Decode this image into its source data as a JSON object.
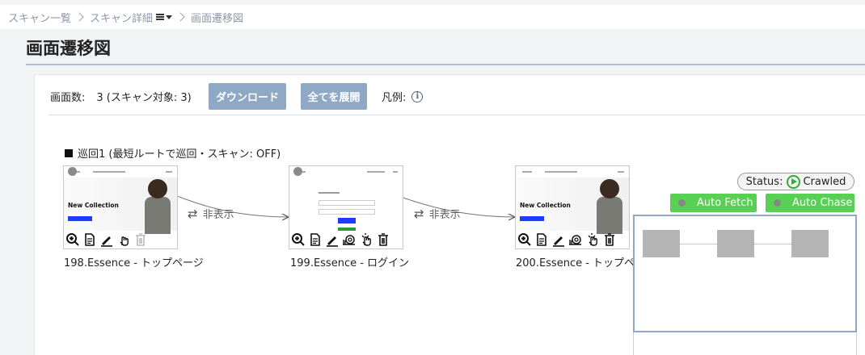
{
  "breadcrumb": {
    "items": [
      "スキャン一覧",
      "スキャン詳細",
      "画面遷移図"
    ]
  },
  "page": {
    "title": "画面遷移図"
  },
  "summary": {
    "screen_count_label": "画面数:",
    "screen_count_value": "3 (スキャン対象: 3)",
    "download_button": "ダウンロード",
    "expand_button": "全てを展開",
    "legend_label": "凡例:",
    "info_glyph": "i"
  },
  "route": {
    "label": "巡回1 (最短ルートで巡回・スキャン: OFF)"
  },
  "nodes": [
    {
      "label": "198.Essence - トップページ",
      "hero": "New Collection"
    },
    {
      "label": "199.Essence - ログイン",
      "hero": ""
    },
    {
      "label": "200.Essence - トップペ",
      "hero": "New Collection"
    }
  ],
  "edge_toggles": [
    "非表示",
    "非表示"
  ],
  "status": {
    "label": "Status:",
    "value": "Crawled",
    "accent": "#2fae35"
  },
  "controls": {
    "auto_fetch": "Auto Fetch",
    "auto_chase": "Auto Chase",
    "button_color": "#58d053"
  },
  "colors": {
    "primary_button": "#8fa8c6",
    "title_rule": "#a9bcd0"
  }
}
